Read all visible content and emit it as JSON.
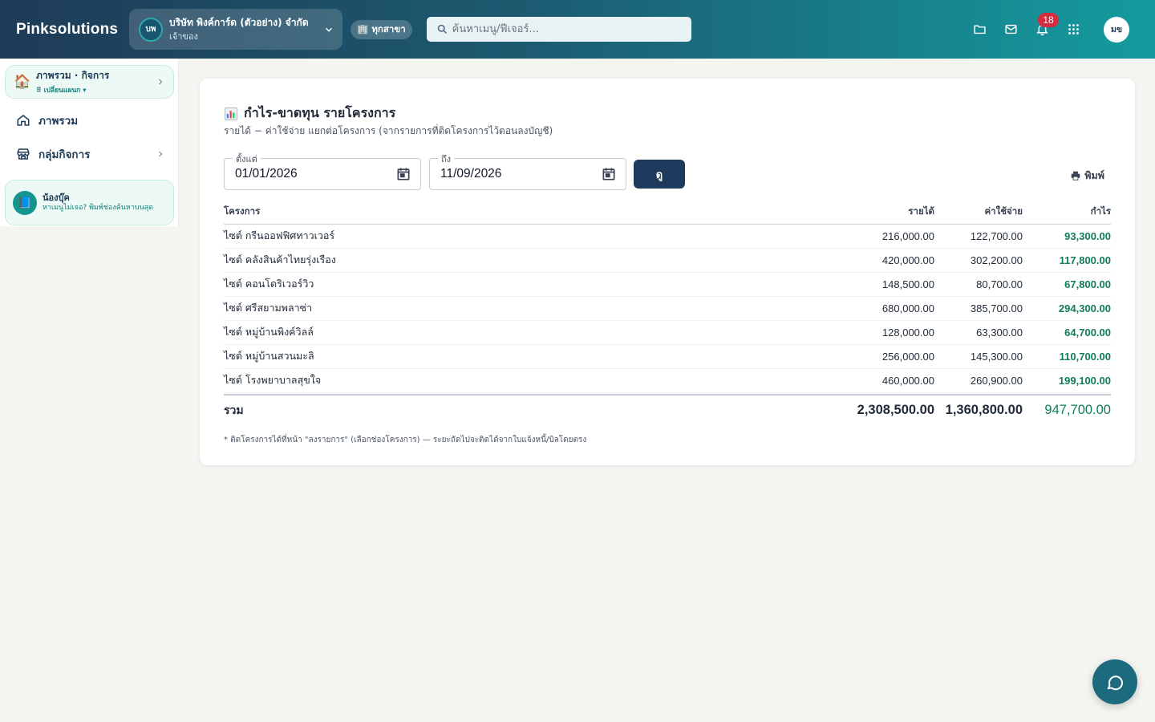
{
  "header": {
    "brand": "Pinksolutions",
    "company": {
      "initials": "บพ",
      "name": "บริษัท พิงค์การ์ด (ตัวอย่าง) จำกัด",
      "role": "เจ้าของ"
    },
    "branch": "🏢 ทุกสาขา",
    "search": {
      "placeholder": "ค้นหาเมนู/ฟีเจอร์..."
    },
    "notification_count": "18",
    "user_initials": "มข",
    "icons": [
      "folder-icon",
      "mail-icon",
      "bell-icon",
      "apps-grid-icon"
    ]
  },
  "sidebar": {
    "workspace": {
      "title": "ภาพรวม · กิจการ",
      "switch_label": "⠿ เปลี่ยนแผนก ▾"
    },
    "items": [
      {
        "label": "ภาพรวม",
        "icon": "home-icon"
      },
      {
        "label": "กลุ่มกิจการ",
        "icon": "store-icon"
      }
    ],
    "assistant": {
      "name": "น้องบุ๊ค",
      "hint": "หาเมนูไม่เจอ? พิมพ์ช่องค้นหาบนสุด"
    }
  },
  "report": {
    "title": "กำไร-ขาดทุน รายโครงการ",
    "subtitle": "รายได้ − ค่าใช้จ่าย แยกต่อโครงการ (จากรายการที่ติดโครงการไว้ตอนลงบัญชี)",
    "from": {
      "label": "ตั้งแต่",
      "value": "01/01/2026"
    },
    "to": {
      "label": "ถึง",
      "value": "11/09/2026"
    },
    "view_button": "ดู",
    "print_label": "พิมพ์",
    "columns": [
      "โครงการ",
      "รายได้",
      "ค่าใช้จ่าย",
      "กำไร"
    ],
    "rows": [
      {
        "project": "ไซต์ กรีนออฟฟิศทาวเวอร์",
        "revenue": "216,000.00",
        "expense": "122,700.00",
        "profit": "93,300.00"
      },
      {
        "project": "ไซต์ คลังสินค้าไทยรุ่งเรือง",
        "revenue": "420,000.00",
        "expense": "302,200.00",
        "profit": "117,800.00"
      },
      {
        "project": "ไซต์ คอนโดริเวอร์วิว",
        "revenue": "148,500.00",
        "expense": "80,700.00",
        "profit": "67,800.00"
      },
      {
        "project": "ไซต์ ศรีสยามพลาซ่า",
        "revenue": "680,000.00",
        "expense": "385,700.00",
        "profit": "294,300.00"
      },
      {
        "project": "ไซต์ หมู่บ้านพิงค์วิลล์",
        "revenue": "128,000.00",
        "expense": "63,300.00",
        "profit": "64,700.00"
      },
      {
        "project": "ไซต์ หมู่บ้านสวนมะลิ",
        "revenue": "256,000.00",
        "expense": "145,300.00",
        "profit": "110,700.00"
      },
      {
        "project": "ไซต์ โรงพยาบาลสุขใจ",
        "revenue": "460,000.00",
        "expense": "260,900.00",
        "profit": "199,100.00"
      }
    ],
    "total": {
      "label": "รวม",
      "revenue": "2,308,500.00",
      "expense": "1,360,800.00",
      "profit": "947,700.00"
    },
    "note": "* ติดโครงการได้ที่หน้า \"ลงรายการ\" (เลือกช่องโครงการ) — ระยะถัดไปจะติดได้จากใบแจ้งหนี้/บิลโดยตรง"
  },
  "colors": {
    "accent": "#1e3b5e",
    "profit": "#0f7d5a",
    "badge": "#d72b3f"
  }
}
